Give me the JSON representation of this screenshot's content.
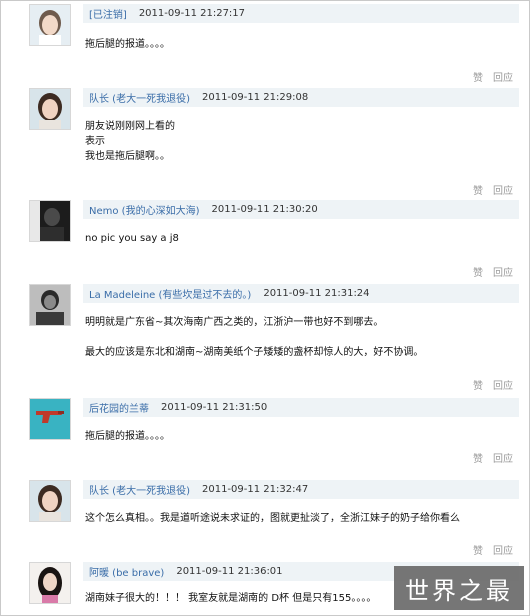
{
  "actions": {
    "like": "赞",
    "reply": "回应"
  },
  "watermark": "世界之最",
  "comments": [
    {
      "author": "[已注销]",
      "time": "2011-09-11 21:27:17",
      "text": "拖后腿的报道。。。。",
      "avatar_icon": "girl-portrait-icon"
    },
    {
      "author": "队长 (老大一死我退役)",
      "time": "2011-09-11 21:29:08",
      "text": "朋友说刚刚网上看的\n表示\n我也是拖后腿啊。。",
      "avatar_icon": "girl-portrait-icon"
    },
    {
      "author": "Nemo (我的心深如大海)",
      "time": "2011-09-11 21:30:20",
      "text": "no pic you say a j8",
      "avatar_icon": "dark-portrait-icon"
    },
    {
      "author": "La Madeleine (有些坎是过不去的。)",
      "time": "2011-09-11 21:31:24",
      "text": "明明就是广东省~其次海南广西之类的，江浙沪一带也好不到哪去。\n\n最大的应该是东北和湖南~湖南美纸个子矮矮的盏杯却惊人的大，好不协调。",
      "avatar_icon": "bw-photo-icon"
    },
    {
      "author": "后花园的兰蒂",
      "time": "2011-09-11 21:31:50",
      "text": "拖后腿的报道。。。。",
      "avatar_icon": "red-gun-icon"
    },
    {
      "author": "队长 (老大一死我退役)",
      "time": "2011-09-11 21:32:47",
      "text": "这个怎么真相。。我是道听途说未求证的，图就更扯淡了，全浙江妹子的奶子给你看么",
      "avatar_icon": "girl-portrait-icon"
    },
    {
      "author": "阿暖 (be brave)",
      "time": "2011-09-11 21:36:01",
      "text": "湖南妹子很大的！！！ 我室友就是湖南的 D杯 但是只有155。。。。",
      "avatar_icon": "girl-dark-hair-icon"
    }
  ]
}
